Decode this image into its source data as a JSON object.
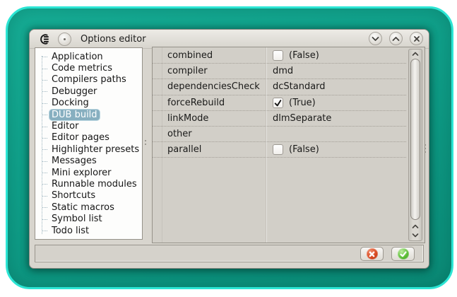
{
  "titlebar": {
    "title": "Options editor",
    "app_icon": "coedit-logo",
    "buttons": {
      "pin": "window-pin",
      "minimize": "chevron-down",
      "maximize": "chevron-up",
      "close": "x"
    }
  },
  "sidebar": {
    "items": [
      "Application",
      "Code metrics",
      "Compilers paths",
      "Debugger",
      "Docking",
      "DUB build",
      "Editor",
      "Editor pages",
      "Highlighter presets",
      "Messages",
      "Mini explorer",
      "Runnable modules",
      "Shortcuts",
      "Static macros",
      "Symbol list",
      "Todo list"
    ],
    "selected": "DUB build"
  },
  "property_grid": {
    "rows": [
      {
        "name": "combined",
        "type": "bool",
        "value": "(False)",
        "checked": false
      },
      {
        "name": "compiler",
        "type": "text",
        "value": "dmd"
      },
      {
        "name": "dependenciesCheck",
        "type": "text",
        "value": "dcStandard"
      },
      {
        "name": "forceRebuild",
        "type": "bool",
        "value": "(True)",
        "checked": true
      },
      {
        "name": "linkMode",
        "type": "text",
        "value": "dlmSeparate"
      },
      {
        "name": "other",
        "type": "text",
        "value": ""
      },
      {
        "name": "parallel",
        "type": "bool",
        "value": "(False)",
        "checked": false
      }
    ]
  },
  "footer": {
    "buttons": [
      {
        "name": "cancel",
        "icon": "red-cross-icon"
      },
      {
        "name": "accept",
        "icon": "green-check-icon"
      }
    ]
  },
  "colors": {
    "frame_teal": "#0f9f89",
    "frame_cyan": "#2ce5d4",
    "window_bg": "#d8d5ce",
    "selection": "#87afc0",
    "cancel_red": "#d8481f",
    "ok_green": "#5dbe37"
  }
}
